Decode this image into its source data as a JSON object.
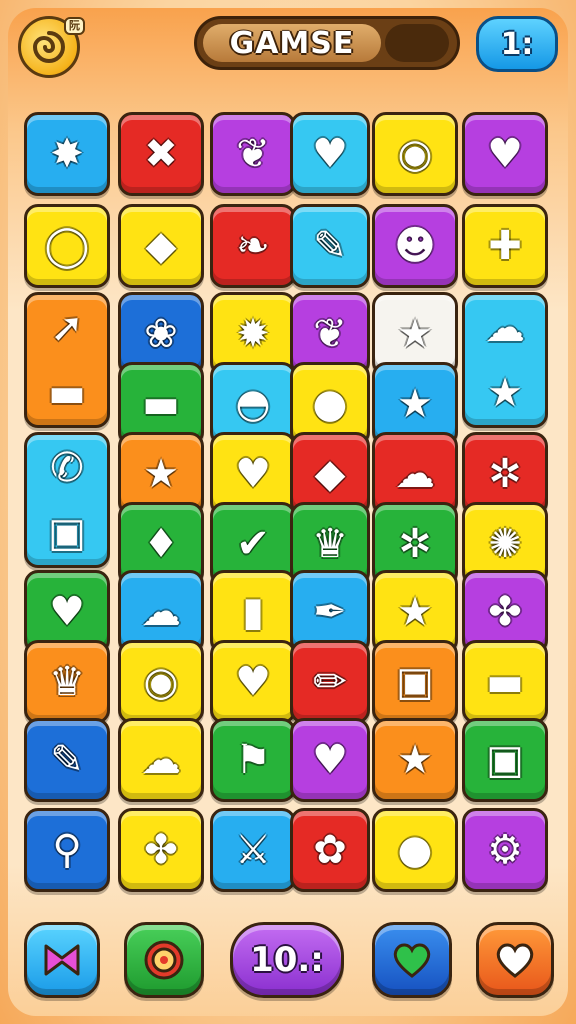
{
  "header": {
    "title": "GAMSE",
    "logo_badge": "阮",
    "score": "1:"
  },
  "colors": {
    "blue": "#27aef0",
    "red": "#e52a25",
    "purple": "#b63fe0",
    "yellow": "#ffe313",
    "green": "#27b33a",
    "orange": "#fb8f1c",
    "white": "#f6f4ef",
    "darkblue": "#1d6fd8",
    "cyan": "#36c8f2"
  },
  "tiles": [
    {
      "color": "blue",
      "icon": "splat-icon",
      "glyph": "✸"
    },
    {
      "color": "red",
      "icon": "crossed-tools-icon",
      "glyph": "✖"
    },
    {
      "color": "purple",
      "icon": "leaf-icon",
      "glyph": "❦"
    },
    {
      "color": "cyan",
      "icon": "heart-icon",
      "glyph": "♥"
    },
    {
      "color": "yellow",
      "icon": "swirl-icon",
      "glyph": "◉"
    },
    {
      "color": "purple",
      "icon": "heart-icon",
      "glyph": "♥"
    },
    {
      "color": "yellow",
      "icon": "ring-icon",
      "glyph": "◯"
    },
    {
      "color": "yellow",
      "icon": "gem-icon",
      "glyph": "◆"
    },
    {
      "color": "red",
      "icon": "petal-icon",
      "glyph": "❧"
    },
    {
      "color": "cyan",
      "icon": "pencil-icon",
      "glyph": "✎"
    },
    {
      "color": "purple",
      "icon": "cow-icon",
      "glyph": "☻"
    },
    {
      "color": "yellow",
      "icon": "plus-icon",
      "glyph": "✚"
    },
    {
      "color": "orange",
      "icon": "arrow-icon",
      "glyph": "➚",
      "tall": true,
      "glyph2": "▬",
      "icon2": "flag-icon"
    },
    {
      "color": "darkblue",
      "icon": "blob-icon",
      "glyph": "❀"
    },
    {
      "color": "yellow",
      "icon": "sun-icon",
      "glyph": "✹"
    },
    {
      "color": "purple",
      "icon": "feather-icon",
      "glyph": "❦"
    },
    {
      "color": "white",
      "icon": "star-icon",
      "glyph": "★"
    },
    {
      "color": "cyan",
      "icon": "cloud-icon",
      "glyph": "☁",
      "tall": true,
      "glyph2": "★",
      "icon2": "star-icon"
    },
    {
      "color": "green",
      "icon": "flag-icon",
      "glyph": "▬"
    },
    {
      "color": "cyan",
      "icon": "gauge-icon",
      "glyph": "◓"
    },
    {
      "color": "yellow",
      "icon": "apple-icon",
      "glyph": "●"
    },
    {
      "color": "blue",
      "icon": "star-icon",
      "glyph": "★"
    },
    {
      "color": "cyan",
      "icon": "phone-icon",
      "glyph": "✆",
      "tall": true,
      "glyph2": "▣",
      "icon2": "square-icon"
    },
    {
      "color": "orange",
      "icon": "star-icon",
      "glyph": "★"
    },
    {
      "color": "yellow",
      "icon": "heart-icon",
      "glyph": "♥"
    },
    {
      "color": "red",
      "icon": "pin-icon",
      "glyph": "◆"
    },
    {
      "color": "red",
      "icon": "bubble-icon",
      "glyph": "☁"
    },
    {
      "color": "red",
      "icon": "gear-icon",
      "glyph": "✲"
    },
    {
      "color": "green",
      "icon": "strawberry-icon",
      "glyph": "♦"
    },
    {
      "color": "green",
      "icon": "check-icon",
      "glyph": "✔"
    },
    {
      "color": "green",
      "icon": "crown-icon",
      "glyph": "♛"
    },
    {
      "color": "green",
      "icon": "cog-icon",
      "glyph": "✲"
    },
    {
      "color": "yellow",
      "icon": "compass-icon",
      "glyph": "✺"
    },
    {
      "color": "green",
      "icon": "heart-icon",
      "glyph": "♥"
    },
    {
      "color": "blue",
      "icon": "mushroom-icon",
      "glyph": "☁"
    },
    {
      "color": "yellow",
      "icon": "bottle-icon",
      "glyph": "▮"
    },
    {
      "color": "blue",
      "icon": "pen-icon",
      "glyph": "✒"
    },
    {
      "color": "yellow",
      "icon": "star-icon",
      "glyph": "★"
    },
    {
      "color": "purple",
      "icon": "puzzle-icon",
      "glyph": "✤"
    },
    {
      "color": "orange",
      "icon": "crown-icon",
      "glyph": "♛"
    },
    {
      "color": "yellow",
      "icon": "lemon-icon",
      "glyph": "◉"
    },
    {
      "color": "yellow",
      "icon": "heart-icon",
      "glyph": "♥"
    },
    {
      "color": "red",
      "icon": "crayon-icon",
      "glyph": "✏"
    },
    {
      "color": "orange",
      "icon": "card-icon",
      "glyph": "▣"
    },
    {
      "color": "yellow",
      "icon": "flag-icon",
      "glyph": "▬"
    },
    {
      "color": "darkblue",
      "icon": "popsicle-icon",
      "glyph": "✎"
    },
    {
      "color": "yellow",
      "icon": "slime-icon",
      "glyph": "☁"
    },
    {
      "color": "green",
      "icon": "flag-icon",
      "glyph": "⚑"
    },
    {
      "color": "purple",
      "icon": "heart-icon",
      "glyph": "♥"
    },
    {
      "color": "orange",
      "icon": "star-icon",
      "glyph": "★"
    },
    {
      "color": "green",
      "icon": "speech-icon",
      "glyph": "▣"
    },
    {
      "color": "darkblue",
      "icon": "magnifier-icon",
      "glyph": "⚲"
    },
    {
      "color": "yellow",
      "icon": "puzzle-icon",
      "glyph": "✤"
    },
    {
      "color": "blue",
      "icon": "sword-icon",
      "glyph": "⚔"
    },
    {
      "color": "red",
      "icon": "flower-icon",
      "glyph": "✿"
    },
    {
      "color": "yellow",
      "icon": "blob-face-icon",
      "glyph": "●"
    },
    {
      "color": "purple",
      "icon": "gear-icon",
      "glyph": "⚙"
    }
  ],
  "bottom_bar": {
    "count": "10.:"
  }
}
